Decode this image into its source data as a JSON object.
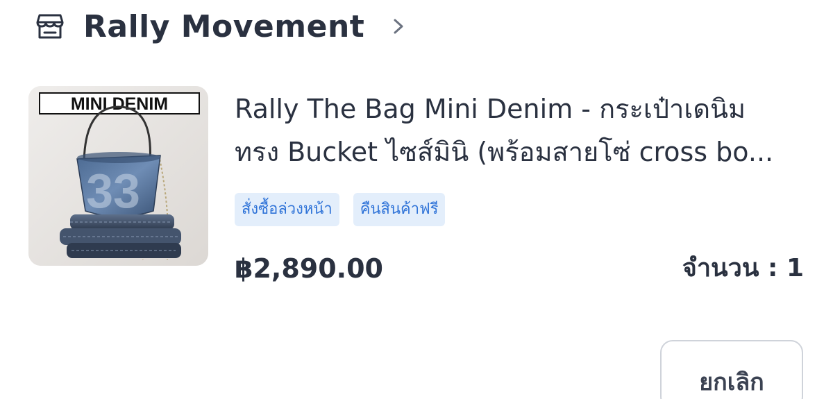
{
  "shop": {
    "name": "Rally Movement",
    "icon": "store-icon",
    "chevron_icon": "chevron-right-icon"
  },
  "product": {
    "image_label": "MINI DENIM",
    "title_line_1": "Rally The Bag Mini Denim - กระเป๋าเดนิม",
    "title_line_2": "ทรง Bucket ไซส์มินิ (พร้อมสายโซ่ cross bo...",
    "badges": [
      "สั่งซื้อล่วงหน้า",
      "คืนสินค้าฟรี"
    ],
    "price": "฿2,890.00",
    "quantity": "จำนวน : 1"
  },
  "actions": {
    "cancel_label": "ยกเลิก"
  },
  "colors": {
    "text_primary": "#2a3140",
    "badge_bg": "#e3eefb",
    "badge_text": "#2f73d8",
    "button_border": "#cfd3da"
  }
}
